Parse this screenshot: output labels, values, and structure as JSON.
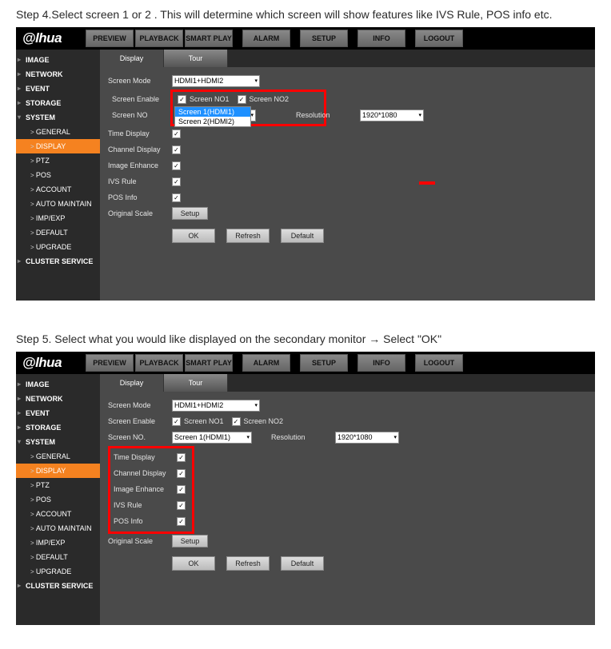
{
  "step4_text": "Step 4.Select screen 1 or 2 . This will determine which screen will show features like IVS Rule, POS info etc.",
  "step5_text": "Step 5. Select what you would like displayed on the secondary monitor → Select \"OK\"",
  "brand": "@lhua",
  "topnav": [
    "PREVIEW",
    "PLAYBACK",
    "SMART PLAY",
    "ALARM",
    "SETUP",
    "INFO",
    "LOGOUT"
  ],
  "sidebar_top": [
    "IMAGE",
    "NETWORK",
    "EVENT",
    "STORAGE"
  ],
  "sidebar_system": "SYSTEM",
  "sidebar_sub": [
    "GENERAL",
    "DISPLAY",
    "PTZ",
    "POS",
    "ACCOUNT",
    "AUTO MAINTAIN",
    "IMP/EXP",
    "DEFAULT",
    "UPGRADE"
  ],
  "sidebar_bottom": "CLUSTER SERVICE",
  "tabs": {
    "display": "Display",
    "tour": "Tour"
  },
  "labels": {
    "screen_mode": "Screen Mode",
    "screen_enable": "Screen Enable",
    "screen_no_s1": "Screen NO",
    "screen_no_s2": "Screen NO.",
    "time_display": "Time Display",
    "channel_display": "Channel Display",
    "image_enhance": "Image Enhance",
    "ivs_rule": "IVS Rule",
    "pos_info": "POS Info",
    "original_scale": "Original Scale",
    "resolution": "Resolution",
    "screen_no1": "Screen NO1",
    "screen_no2": "Screen NO2"
  },
  "values": {
    "screen_mode": "HDMI1+HDMI2",
    "screen_no_sel": "Screen 1(HDMI1)",
    "dropdown_opt1": "Screen 1(HDMI1)",
    "dropdown_opt2": "Screen 2(HDMI2)",
    "resolution": "1920*1080"
  },
  "buttons": {
    "setup": "Setup",
    "ok": "OK",
    "refresh": "Refresh",
    "default": "Default"
  }
}
